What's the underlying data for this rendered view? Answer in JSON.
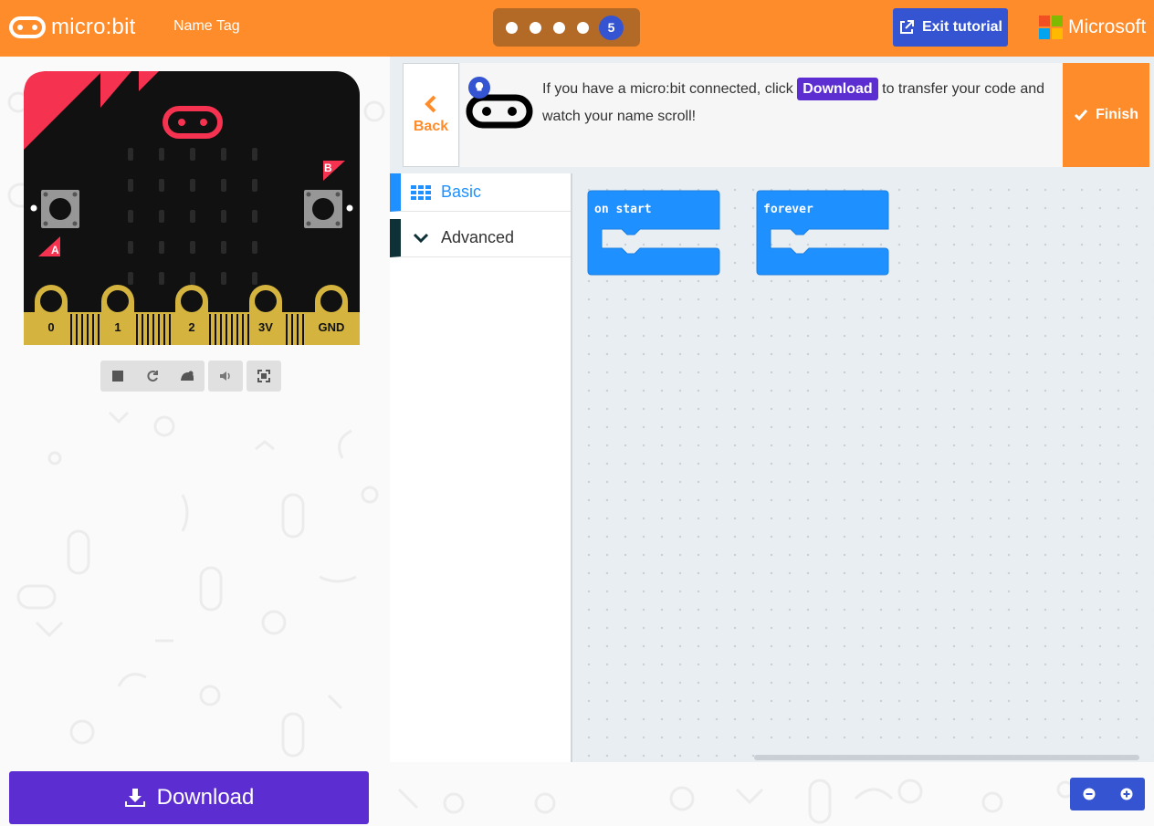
{
  "header": {
    "brand": "micro:bit",
    "project_name": "Name Tag",
    "tutorial_steps": {
      "total": 5,
      "current": "5"
    },
    "exit_label": "Exit tutorial",
    "company": "Microsoft"
  },
  "simulator": {
    "pins": [
      "0",
      "1",
      "2",
      "3V",
      "GND"
    ],
    "button_a": "A",
    "button_b": "B",
    "controls": [
      "stop-icon",
      "restart-icon",
      "slow-motion-icon",
      "mute-icon",
      "fullscreen-icon"
    ]
  },
  "tutorial": {
    "back_label": "Back",
    "hint_before": "If you have a micro:bit connected, click",
    "hint_chip": "Download",
    "hint_after": "to transfer your code and watch your name scroll!",
    "finish_label": "Finish"
  },
  "toolbox": {
    "categories": [
      {
        "label": "Basic",
        "color": "#1e90ff"
      },
      {
        "label": "Advanced",
        "color": "#0d3136"
      }
    ]
  },
  "workspace": {
    "blocks": [
      {
        "label": "on start"
      },
      {
        "label": "forever"
      }
    ]
  },
  "footer": {
    "download_label": "Download",
    "zoom_out": "zoom-out-icon",
    "zoom_in": "zoom-in-icon"
  },
  "colors": {
    "header": "#ff8c2a",
    "accent_blue": "#3454d1",
    "download_purple": "#5c2dd1",
    "block_blue": "#1e90ff"
  }
}
